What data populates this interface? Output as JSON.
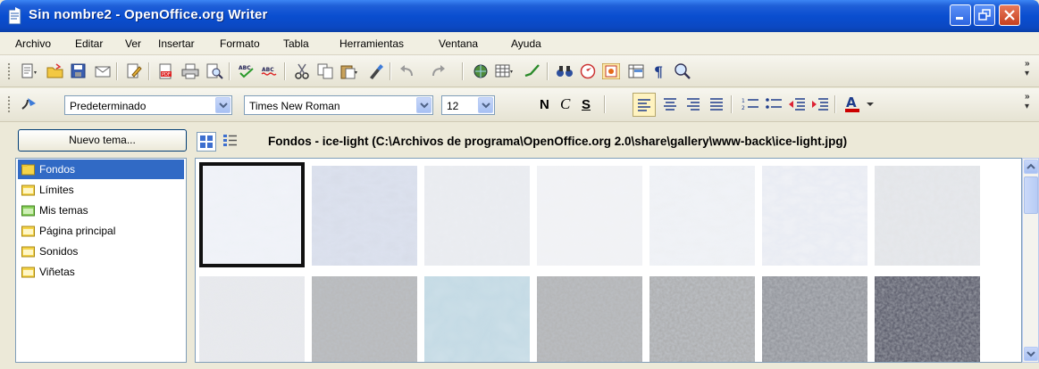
{
  "window": {
    "title": "Sin nombre2 - OpenOffice.org Writer"
  },
  "menu": [
    "Archivo",
    "Editar",
    "Ver",
    "Insertar",
    "Formato",
    "Tabla",
    "Herramientas",
    "Ventana",
    "Ayuda"
  ],
  "format_bar": {
    "style": "Predeterminado",
    "font": "Times New Roman",
    "size": "12",
    "bold": "N",
    "italic": "C",
    "underline": "S"
  },
  "gallery": {
    "new_theme_button": "Nuevo tema...",
    "themes": [
      "Fondos",
      "Límites",
      "Mis temas",
      "Página principal",
      "Sonidos",
      "Viñetas"
    ],
    "selected_theme": "Fondos",
    "title": "Fondos - ice-light (C:\\Archivos de programa\\OpenOffice.org 2.0\\share\\gallery\\www-back\\ice-light.jpg)",
    "thumbnails": [
      "ice-light",
      "ice-1",
      "ice-2",
      "ice-3",
      "ice-4",
      "ice-5",
      "ice-6",
      "stone-1",
      "stone-2",
      "stone-3",
      "stone-4",
      "stone-5",
      "stone-6",
      "stone-7"
    ]
  },
  "colors": {
    "title_bar": "#0a4ed0",
    "selection": "#316ac5",
    "font_color_accent": "#cc0000"
  }
}
